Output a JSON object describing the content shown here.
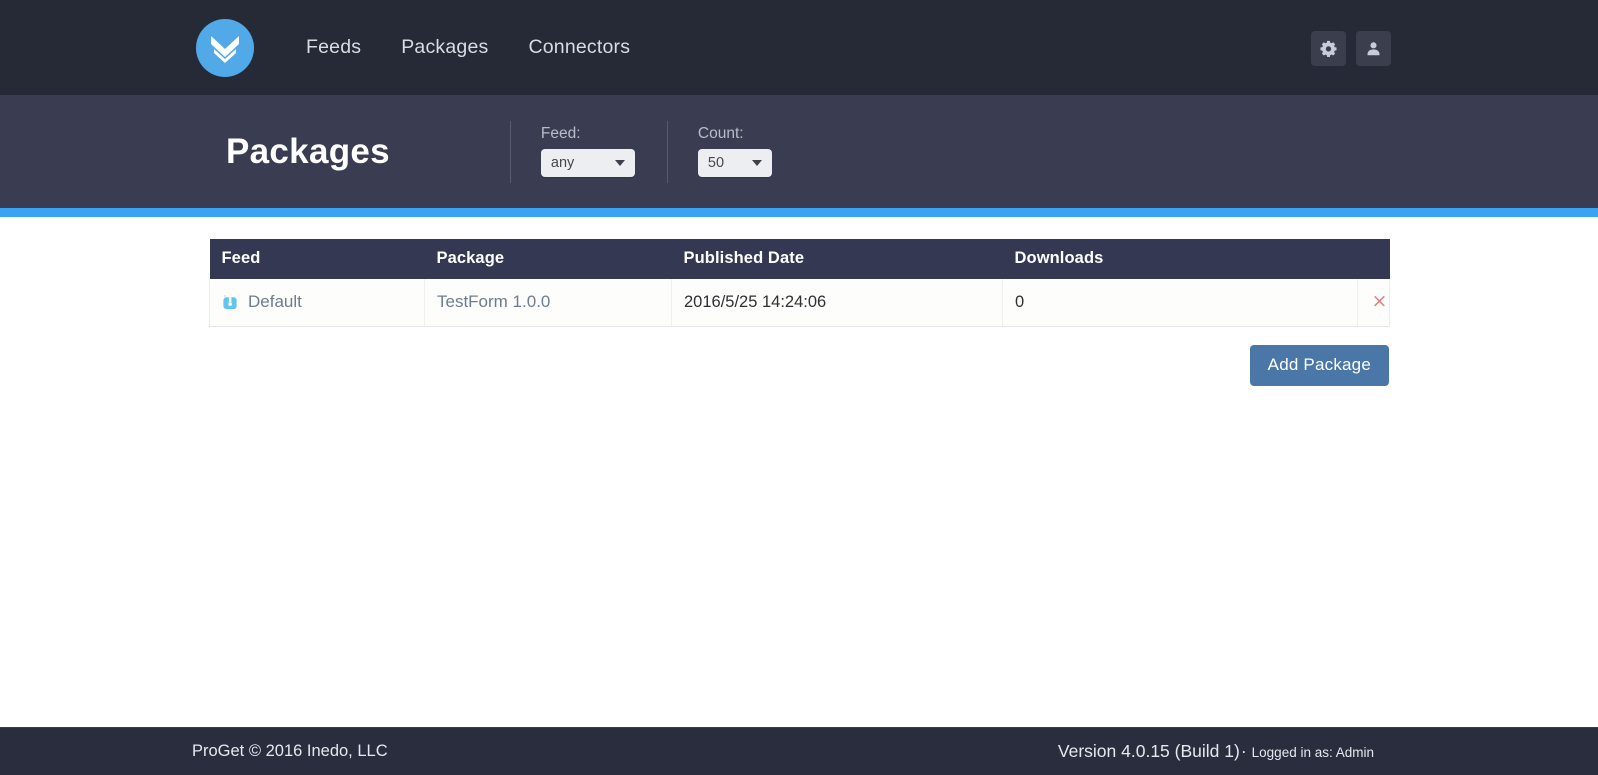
{
  "nav": {
    "logo_icon": "double-chevron-down-logo",
    "links": [
      {
        "label": "Feeds"
      },
      {
        "label": "Packages"
      },
      {
        "label": "Connectors"
      }
    ],
    "settings_icon": "gear-icon",
    "user_icon": "user-icon"
  },
  "subheader": {
    "title": "Packages",
    "filters": [
      {
        "label": "Feed:",
        "value": "any"
      },
      {
        "label": "Count:",
        "value": "50"
      }
    ]
  },
  "table": {
    "headers": [
      "Feed",
      "Package",
      "Published Date",
      "Downloads"
    ],
    "rows": [
      {
        "feed_icon": "package-box-icon",
        "feed": "Default",
        "package": "TestForm 1.0.0",
        "published_date": "2016/5/25 14:24:06",
        "downloads": "0",
        "delete_icon": "close-x-icon",
        "delete_label": "×"
      }
    ]
  },
  "actions": {
    "add_package_label": "Add Package"
  },
  "footer": {
    "copyright": "ProGet © 2016 Inedo, LLC",
    "version": "Version 4.0.15 (Build 1)",
    "separator": "·",
    "logged_in_as": "Logged in as: Admin"
  },
  "colors": {
    "topnav_bg": "#262936",
    "subheader_bg": "#3a3d52",
    "accent": "#3ba4f2",
    "table_header_bg": "#343852",
    "logo_blue": "#52a9e8",
    "primary_button": "#4a77a8",
    "link": "#6e7d8d",
    "delete": "#e38080",
    "footer_bg": "#2a2d3e"
  }
}
